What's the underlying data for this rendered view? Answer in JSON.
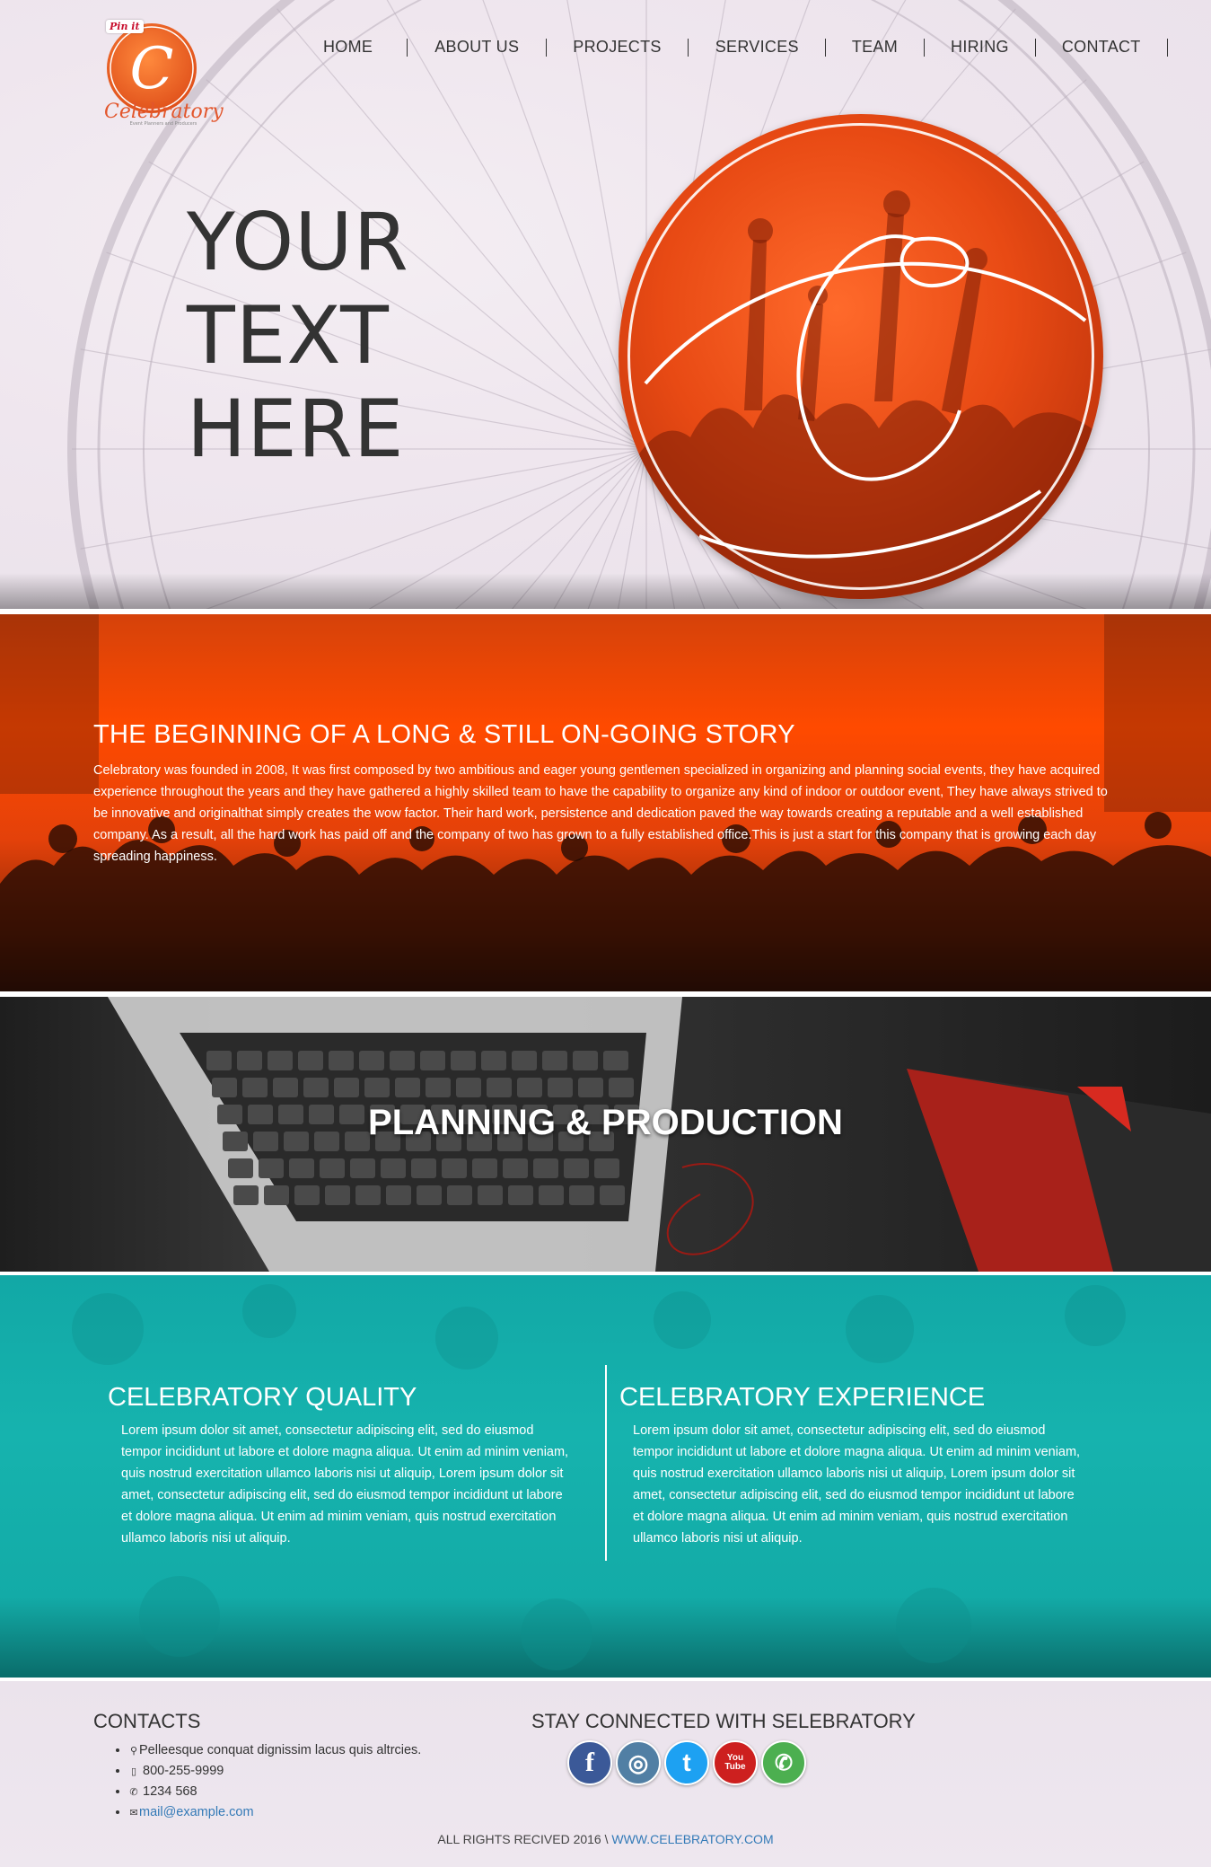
{
  "logo": {
    "pin_label": "Pin it",
    "letter": "C",
    "name": "Celebratory",
    "tagline": "Event Planners and Producers"
  },
  "nav": {
    "items": [
      "HOME",
      "ABOUT US",
      "PROJECTS",
      "SERVICES",
      "TEAM",
      "HIRING",
      "CONTACT"
    ]
  },
  "hero": {
    "title_lines": [
      "YOUR",
      "TEXT",
      "HERE"
    ]
  },
  "story": {
    "heading": "THE BEGINNING OF A LONG & STILL ON-GOING STORY",
    "body": "Celebratory was founded in 2008, It was first composed by two ambitious and eager young gentlemen specialized in organizing and planning social events, they have acquired experience throughout the years and they have gathered a highly skilled team to have the capability to organize any kind of indoor or outdoor event, They have always strived to be innovative and originalthat simply creates the wow factor. Their hard work, persistence and dedication paved the way towards creating a reputable and a well established company. As a result, all the hard work has paid off and the company of two has grown to a fully established office.This is just a start for this company that is growing each day spreading happiness."
  },
  "planning": {
    "heading": "PLANNING & PRODUCTION"
  },
  "quality": {
    "left": {
      "heading": "CELEBRATORY QUALITY",
      "body": "Lorem ipsum dolor sit amet, consectetur adipiscing elit, sed do eiusmod tempor incididunt ut labore et dolore magna aliqua. Ut enim ad minim veniam, quis nostrud exercitation ullamco laboris nisi ut aliquip, Lorem ipsum dolor sit amet, consectetur adipiscing elit, sed do eiusmod tempor incididunt ut labore et dolore magna aliqua. Ut enim ad minim veniam, quis nostrud exercitation ullamco laboris nisi ut aliquip."
    },
    "right": {
      "heading": "CELEBRATORY EXPERIENCE",
      "body": "Lorem ipsum dolor sit amet, consectetur adipiscing elit, sed do eiusmod tempor incididunt ut labore et dolore magna aliqua. Ut enim ad minim veniam, quis nostrud exercitation ullamco laboris nisi ut aliquip, Lorem ipsum dolor sit amet, consectetur adipiscing elit, sed do eiusmod tempor incididunt ut labore et dolore magna aliqua. Ut enim ad minim veniam, quis nostrud exercitation ullamco laboris nisi ut aliquip."
    }
  },
  "footer": {
    "contacts_heading": "CONTACTS",
    "contacts": [
      {
        "icon": "map-marker-icon",
        "text": "Pelleesque conquat dignissim lacus quis altrcies."
      },
      {
        "icon": "mobile-icon",
        "text": "800-255-9999"
      },
      {
        "icon": "phone-icon",
        "text": "1234 568"
      },
      {
        "icon": "envelope-icon",
        "text": "mail@example.com"
      }
    ],
    "stay_heading": "STAY CONNECTED WITH SELEBRATORY",
    "social": [
      {
        "icon": "facebook-icon",
        "glyph": "f",
        "color": "#3b5998"
      },
      {
        "icon": "instagram-icon",
        "glyph": "◎",
        "color": "#517fa4"
      },
      {
        "icon": "twitter-icon",
        "glyph": "t",
        "color": "#1da1f2"
      },
      {
        "icon": "youtube-icon",
        "glyph": "You Tube",
        "color": "#cd201f"
      },
      {
        "icon": "whatsapp-icon",
        "glyph": "✆",
        "color": "#4caf50"
      }
    ],
    "copyright_text": "ALL RIGHTS RECIVED 2016 \\ ",
    "copyright_link": "WWW.CELEBRATORY.COM"
  },
  "colors": {
    "accent": "#ff4a00",
    "teal": "#16b3ae",
    "link": "#337ab7"
  }
}
